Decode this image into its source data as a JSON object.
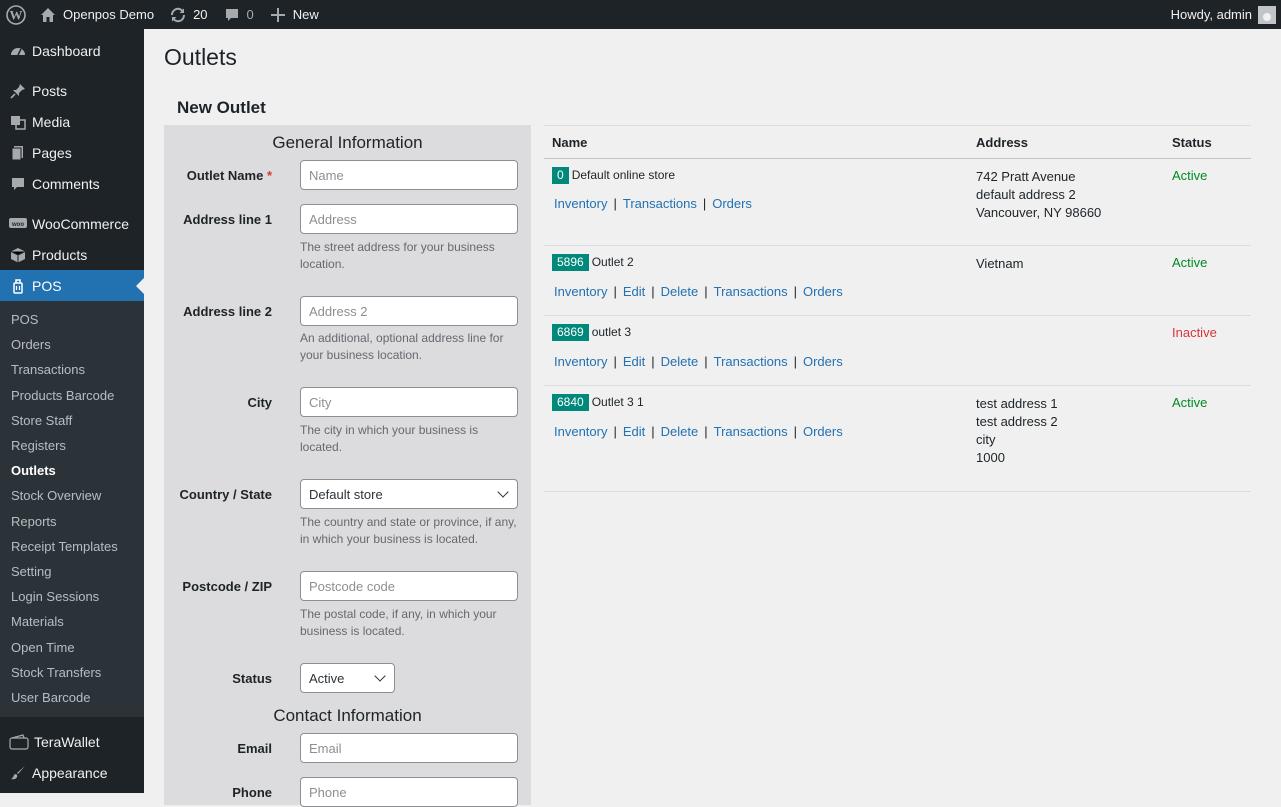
{
  "adminbar": {
    "site_name": "Openpos Demo",
    "updates_count": "20",
    "comments_count": "0",
    "new_label": "New",
    "greeting": "Howdy, admin"
  },
  "sidebar": {
    "dashboard": "Dashboard",
    "posts": "Posts",
    "media": "Media",
    "pages": "Pages",
    "comments": "Comments",
    "woocommerce": "WooCommerce",
    "products": "Products",
    "pos": "POS",
    "submenu": [
      "POS",
      "Orders",
      "Transactions",
      "Products Barcode",
      "Store Staff",
      "Registers",
      "Outlets",
      "Stock Overview",
      "Reports",
      "Receipt Templates",
      "Setting",
      "Login Sessions",
      "Materials",
      "Open Time",
      "Stock Transfers",
      "User Barcode"
    ],
    "terawallet": "TeraWallet",
    "appearance": "Appearance"
  },
  "page": {
    "title": "Outlets",
    "section_title": "New Outlet"
  },
  "form": {
    "general_heading": "General Information",
    "contact_heading": "Contact Information",
    "outlet_name_label": "Outlet Name",
    "required_mark": "*",
    "outlet_name_placeholder": "Name",
    "address1_label": "Address line 1",
    "address1_placeholder": "Address",
    "address1_help": "The street address for your business location.",
    "address2_label": "Address line 2",
    "address2_placeholder": "Address 2",
    "address2_help": "An additional, optional address line for your business location.",
    "city_label": "City",
    "city_placeholder": "City",
    "city_help": "The city in which your business is located.",
    "country_label": "Country / State",
    "country_value": "Default store",
    "country_help": "The country and state or province, if any, in which your business is located.",
    "postcode_label": "Postcode / ZIP",
    "postcode_placeholder": "Postcode code",
    "postcode_help": "The postal code, if any, in which your business is located.",
    "status_label": "Status",
    "status_value": "Active",
    "email_label": "Email",
    "email_placeholder": "Email",
    "phone_label": "Phone",
    "phone_placeholder": "Phone"
  },
  "table": {
    "headers": {
      "name": "Name",
      "address": "Address",
      "status": "Status"
    },
    "rows": [
      {
        "id": "0",
        "name": "Default online store",
        "actions": [
          "Inventory",
          "Transactions",
          "Orders"
        ],
        "address": [
          "742 Pratt Avenue",
          "default address 2",
          "Vancouver, NY 98660"
        ],
        "status": "Active"
      },
      {
        "id": "5896",
        "name": "Outlet 2",
        "actions": [
          "Inventory",
          "Edit",
          "Delete",
          "Transactions",
          "Orders"
        ],
        "address": [
          "Vietnam"
        ],
        "status": "Active"
      },
      {
        "id": "6869",
        "name": "outlet 3",
        "actions": [
          "Inventory",
          "Edit",
          "Delete",
          "Transactions",
          "Orders"
        ],
        "address": [],
        "status": "Inactive"
      },
      {
        "id": "6840",
        "name": "Outlet 3 1",
        "actions": [
          "Inventory",
          "Edit",
          "Delete",
          "Transactions",
          "Orders"
        ],
        "address": [
          "test address 1",
          "test address 2",
          "city",
          "1000"
        ],
        "status": "Active"
      }
    ]
  },
  "colors": {
    "adminbar_bg": "#1d2327",
    "accent": "#2271b1",
    "badge": "#00897b",
    "active": "#008a20",
    "inactive": "#d63638"
  }
}
